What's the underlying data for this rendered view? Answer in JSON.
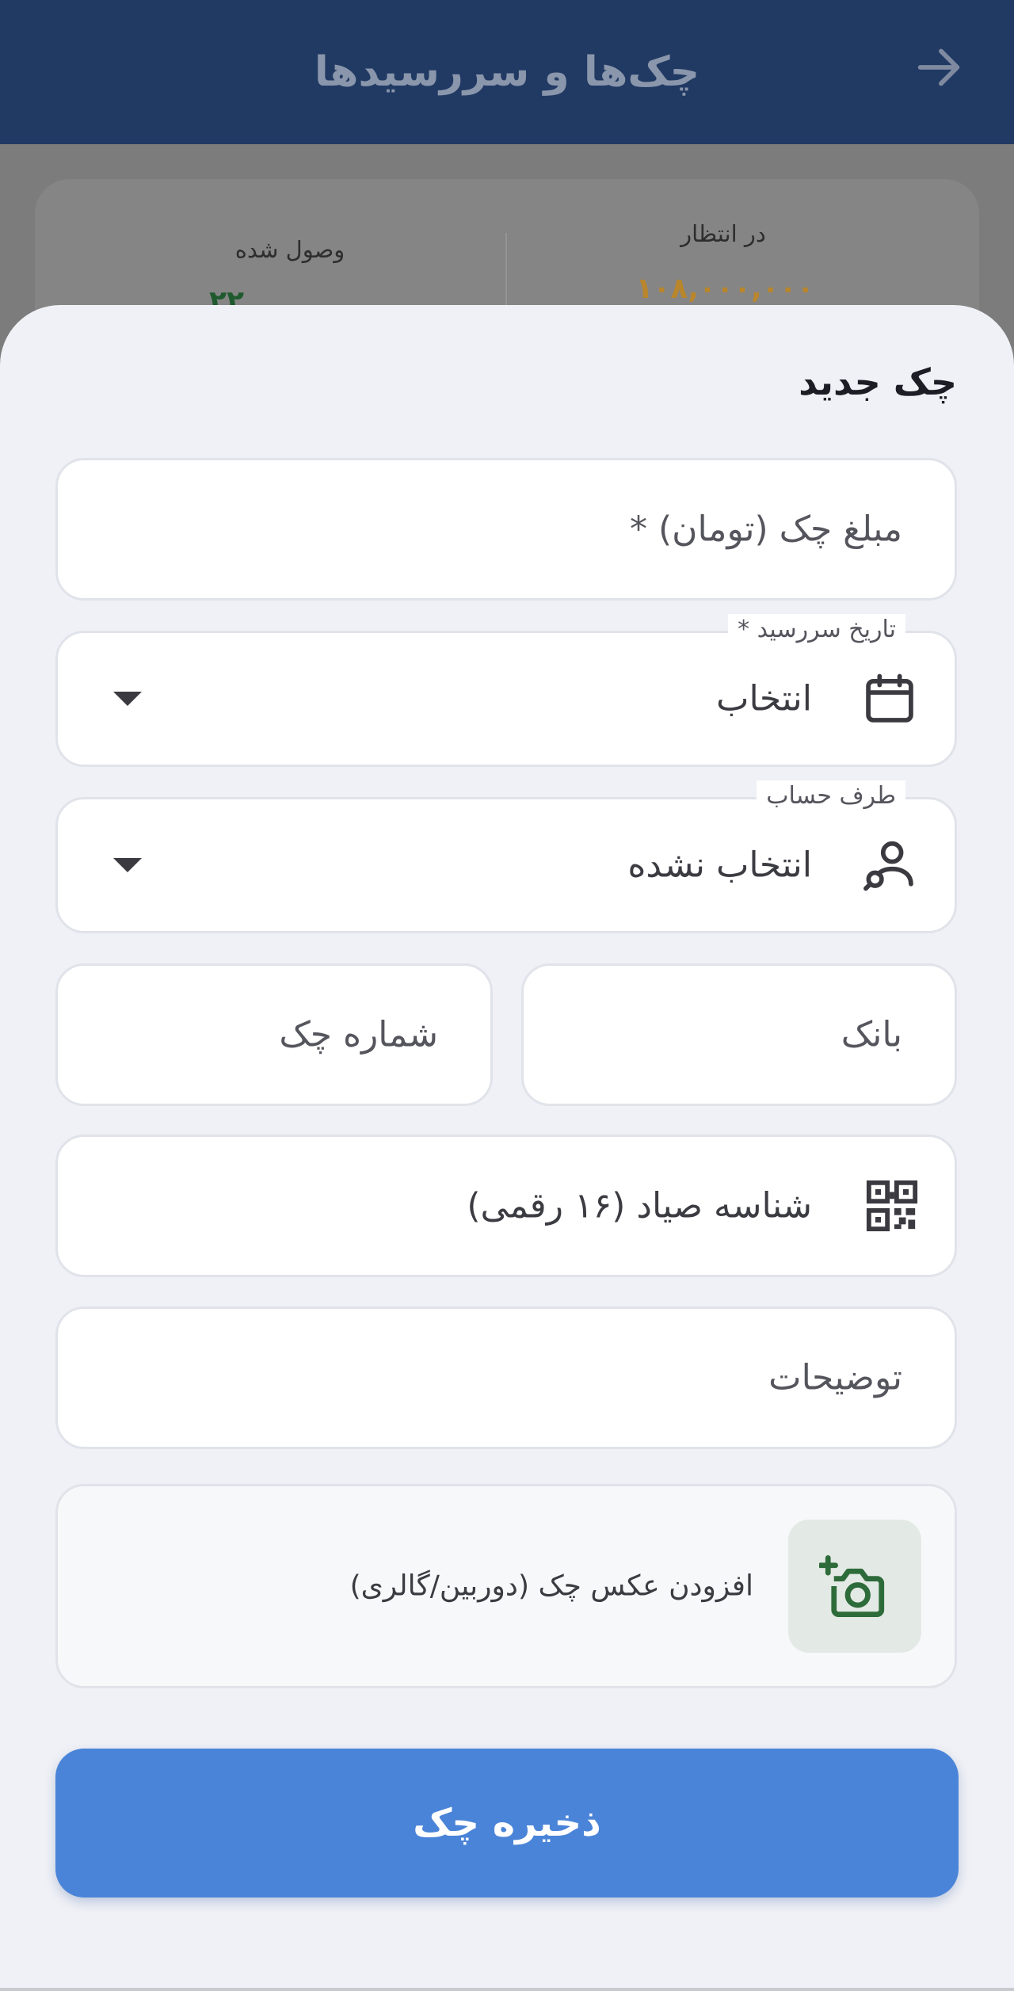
{
  "app_bar": {
    "title": "چک‌ها و سررسیدها",
    "back_icon": "arrow-right-icon"
  },
  "stats": {
    "pending_label": "در انتظار",
    "pending_value": "۱۰۸,۰۰۰,۰۰۰",
    "received_label": "وصول شده",
    "received_value": "۲۲",
    "pending_color": "#b9862c",
    "received_color": "#1f5a2e"
  },
  "sheet": {
    "title": "چک جدید",
    "amount_placeholder": "مبلغ چک (تومان) *",
    "due_date": {
      "label": "تاریخ سررسید *",
      "value": "انتخاب",
      "icon": "calendar-icon"
    },
    "counterparty": {
      "label": "طرف حساب",
      "value": "انتخاب نشده",
      "icon": "person-search-icon"
    },
    "bank_placeholder": "بانک",
    "check_number_placeholder": "شماره چک",
    "sayad_placeholder": "شناسه صیاد (۱۶ رقمی)",
    "sayad_icon": "qr-code-icon",
    "notes_placeholder": "توضیحات",
    "add_photo_label": "افزودن عکس چک (دوربین/گالری)",
    "add_photo_icon": "add-camera-icon",
    "save_label": "ذخیره چک"
  },
  "colors": {
    "app_bar": "#213a64",
    "primary_button": "#4a84d8",
    "photo_icon": "#2e6b3a"
  }
}
